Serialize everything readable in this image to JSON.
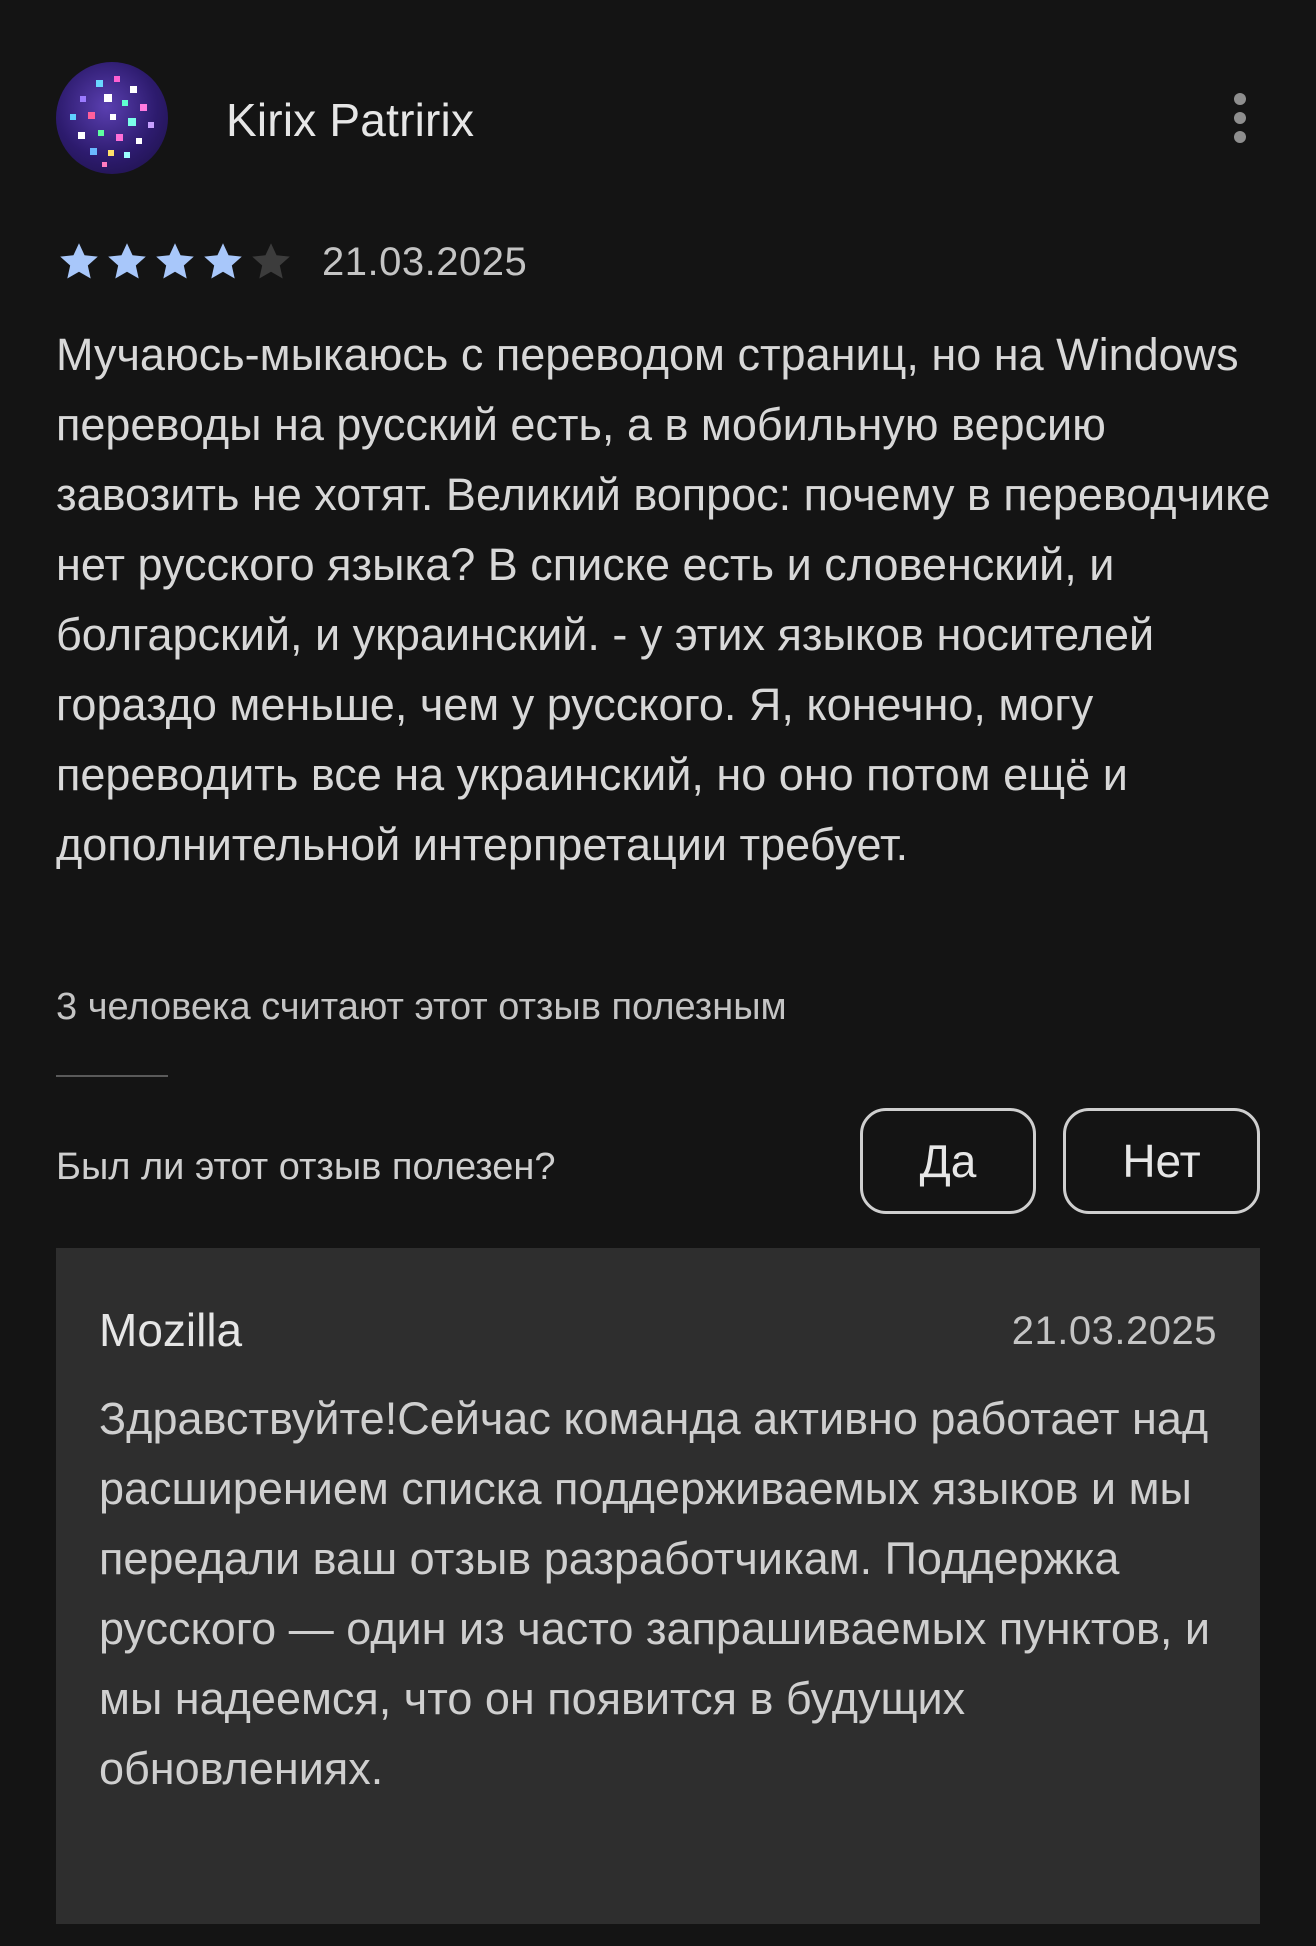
{
  "review": {
    "author": "Kirix Patririx",
    "avatar_icon": "pixel-dots-avatar",
    "more_icon": "more-vertical-icon",
    "rating": 4,
    "rating_max": 5,
    "date": "21.03.2025",
    "text": "Мучаюсь-мыкаюсь с переводом страниц, но на Windows переводы на русский есть, а в мобильную версию завозить не хотят. Великий вопрос: почему в переводчике нет русского языка? В списке есть и словенский, и болгарский, и украинский. - у этих языков носителей гораздо меньше, чем у русского. Я, конечно, могу переводить все на украинский, но оно потом ещё и дополнительной интерпретации требует.",
    "helpful_count_text": "3 человека считают этот отзыв полезным"
  },
  "feedback": {
    "question": "Был ли этот отзыв полезен?",
    "yes_label": "Да",
    "no_label": "Нет"
  },
  "developer_reply": {
    "author": "Mozilla",
    "date": "21.03.2025",
    "text": "Здравствуйте!Сейчас команда активно работает над расширением списка поддерживаемых языков и мы передали ваш отзыв разработчикам. Поддержка русского — один из часто запрашиваемых пунктов, и мы надеемся, что он появится в будущих обновлениях."
  },
  "colors": {
    "background": "#141414",
    "star_filled": "#a8c7fa",
    "star_empty": "#3c3c3c",
    "reply_background": "#2e2e2e"
  }
}
